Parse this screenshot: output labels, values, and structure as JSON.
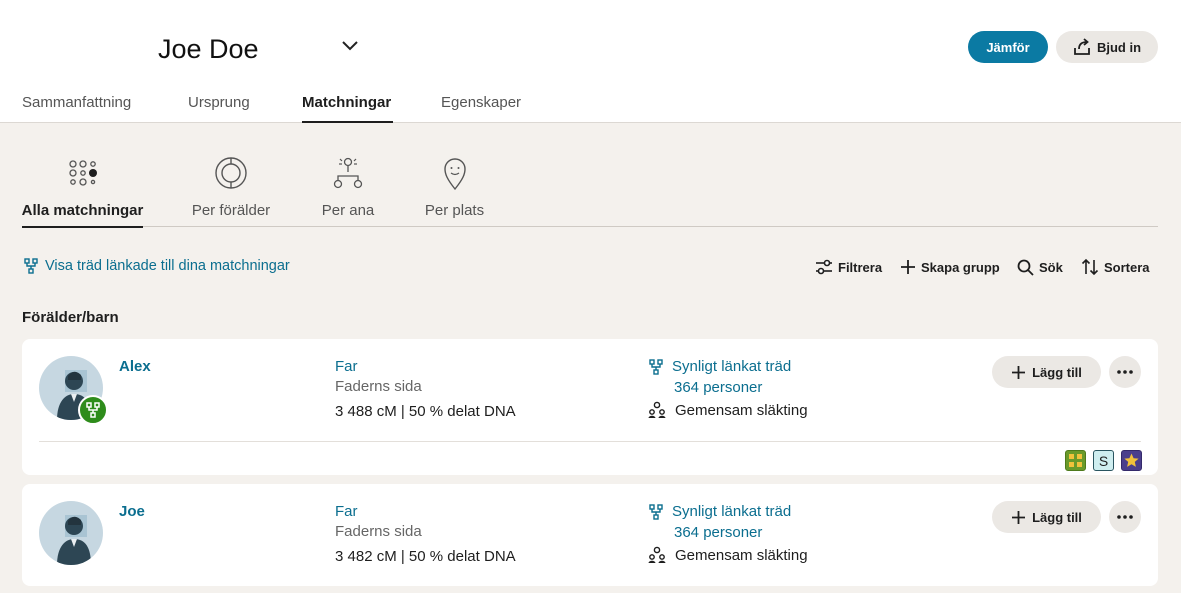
{
  "header": {
    "person_name": "Joe Doe",
    "compare_label": "Jämför",
    "invite_label": "Bjud in"
  },
  "main_tabs": [
    {
      "label": "Sammanfattning"
    },
    {
      "label": "Ursprung"
    },
    {
      "label": "Matchningar"
    },
    {
      "label": "Egenskaper"
    }
  ],
  "subtabs": [
    {
      "label": "Alla matchningar",
      "icon": "all-matches-icon"
    },
    {
      "label": "Per förälder",
      "icon": "per-parent-icon"
    },
    {
      "label": "Per ana",
      "icon": "per-ancestor-icon"
    },
    {
      "label": "Per plats",
      "icon": "per-place-icon"
    }
  ],
  "toolbar": {
    "tree_link": "Visa träd länkade till dina matchningar",
    "filter": "Filtrera",
    "create_group": "Skapa grupp",
    "search": "Sök",
    "sort": "Sortera"
  },
  "section_title": "Förälder/barn",
  "matches": [
    {
      "name": "Alex",
      "relationship": "Far",
      "side": "Faderns sida",
      "dna": "3 488 cM | 50 % delat DNA",
      "linked_tree": "Synligt länkat träd",
      "tree_count": "364 personer",
      "common_ancestor": "Gemensam släkting",
      "add_label": "Lägg till",
      "tags": [
        "S"
      ]
    },
    {
      "name": "Joe",
      "relationship": "Far",
      "side": "Faderns sida",
      "dna": "3 482 cM | 50 % delat DNA",
      "linked_tree": "Synligt länkat träd",
      "tree_count": "364 personer",
      "common_ancestor": "Gemensam släkting",
      "add_label": "Lägg till"
    }
  ],
  "colors": {
    "accent": "#0b7aa3",
    "link": "#0b6e8f",
    "background": "#f4f1ed",
    "tree_badge": "#2e8c1b"
  }
}
